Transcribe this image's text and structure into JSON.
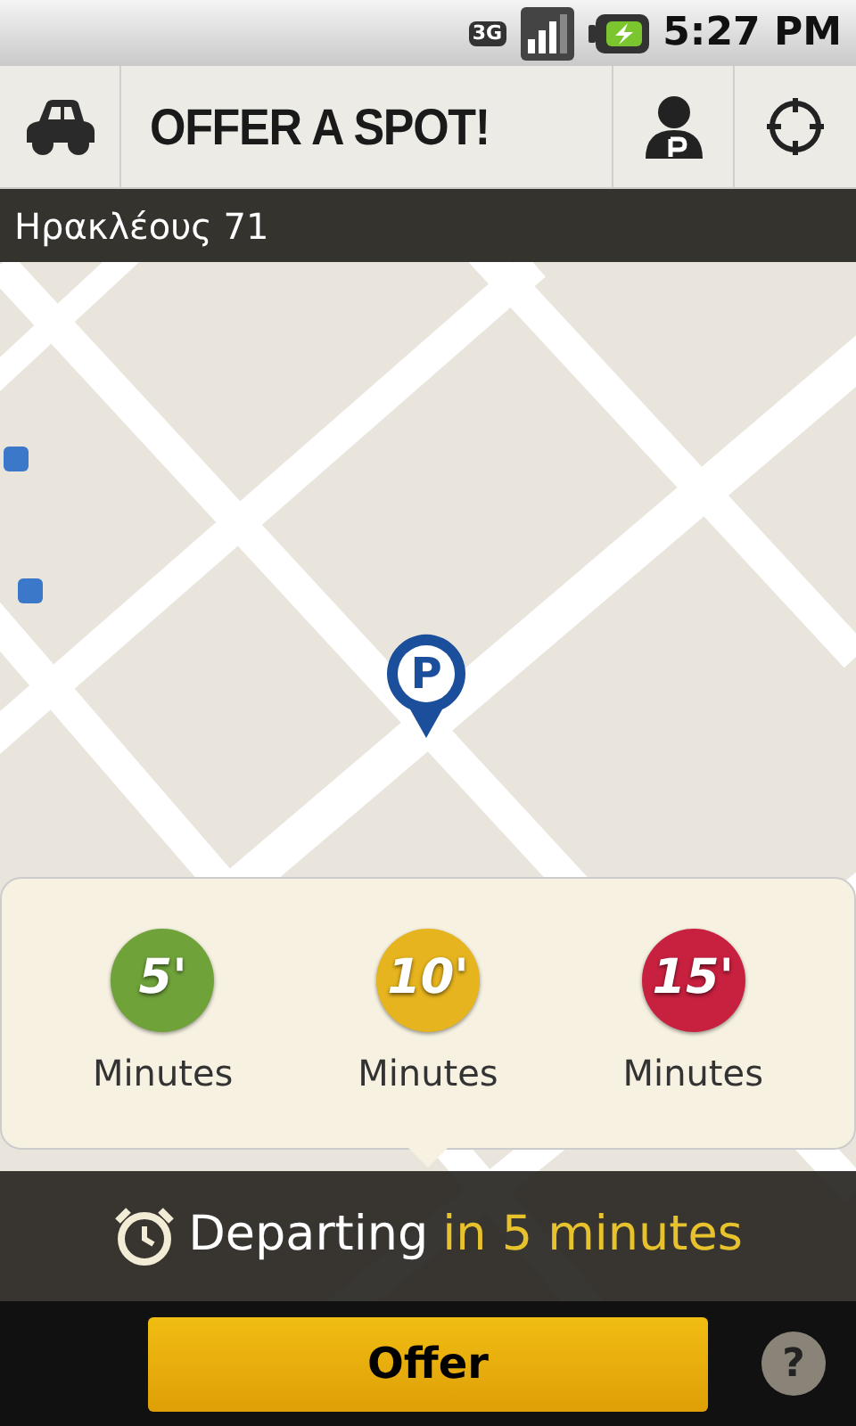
{
  "status_bar": {
    "time": "5:27 PM",
    "network": "3G"
  },
  "app_bar": {
    "title": "OFFER A SPOT!"
  },
  "address": "Ηρακλέους 71",
  "map": {
    "marker": "P"
  },
  "time_options": [
    {
      "value": "5'",
      "label": "Minutes",
      "color": "#6fa33a"
    },
    {
      "value": "10'",
      "label": "Minutes",
      "color": "#e6b41e"
    },
    {
      "value": "15'",
      "label": "Minutes",
      "color": "#c8203f"
    }
  ],
  "departing": {
    "label": "Departing",
    "time": "in 5 minutes"
  },
  "offer_button": "Offer",
  "help_button": "?"
}
